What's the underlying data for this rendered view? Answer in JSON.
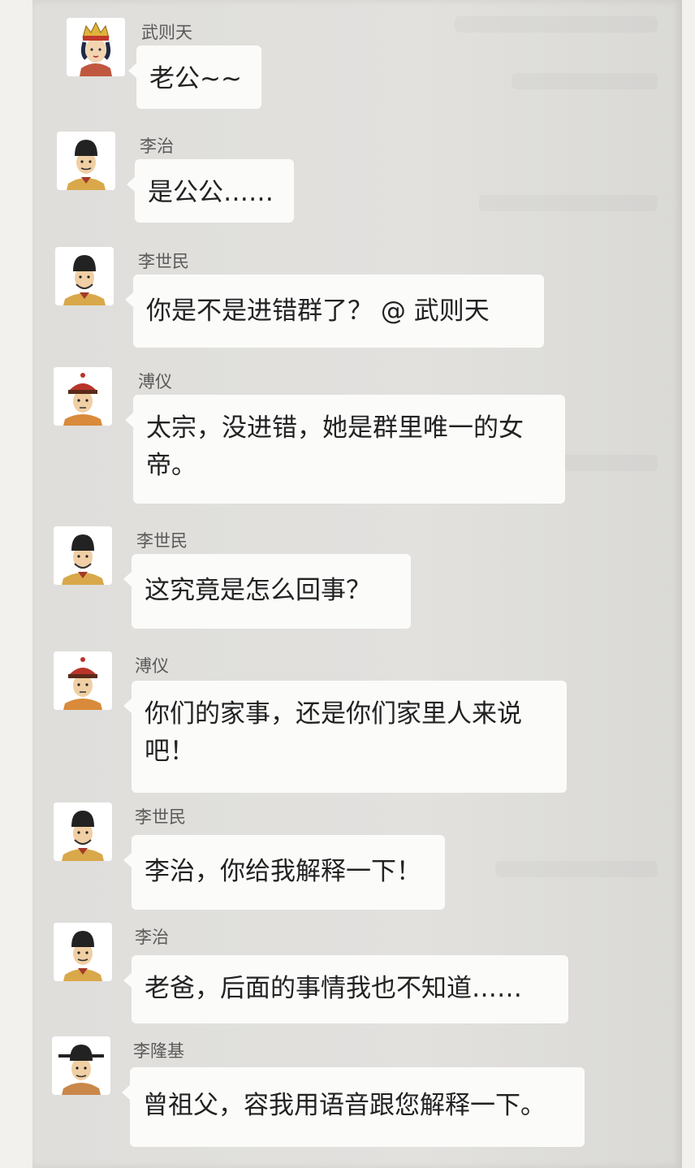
{
  "messages": [
    {
      "sender": "武则天",
      "text": "老公~~",
      "avatar": "empress-avatar-icon"
    },
    {
      "sender": "李治",
      "text": "是公公……",
      "avatar": "tang-emperor-avatar-icon"
    },
    {
      "sender": "李世民",
      "text": "你是不是进错群了？ @ 武则天",
      "avatar": "tang-emperor-avatar-icon"
    },
    {
      "sender": "溥仪",
      "text": "太宗，没进错，她是群里唯一的女帝。",
      "avatar": "qing-emperor-avatar-icon"
    },
    {
      "sender": "李世民",
      "text": "这究竟是怎么回事？",
      "avatar": "tang-emperor-avatar-icon"
    },
    {
      "sender": "溥仪",
      "text": "你们的家事，还是你们家里人来说吧！",
      "avatar": "qing-emperor-avatar-icon"
    },
    {
      "sender": "李世民",
      "text": "李治，你给我解释一下！",
      "avatar": "tang-emperor-avatar-icon"
    },
    {
      "sender": "李治",
      "text": "老爸，后面的事情我也不知道……",
      "avatar": "tang-emperor-avatar-icon"
    },
    {
      "sender": "李隆基",
      "text": "曾祖父，容我用语音跟您解释一下。",
      "avatar": "tang-emperor-avatar-icon"
    }
  ],
  "colors": {
    "background": "#e0dfdc",
    "bubble": "#fbfbfa",
    "sender_text": "#5a5a5a",
    "message_text": "#222222"
  }
}
